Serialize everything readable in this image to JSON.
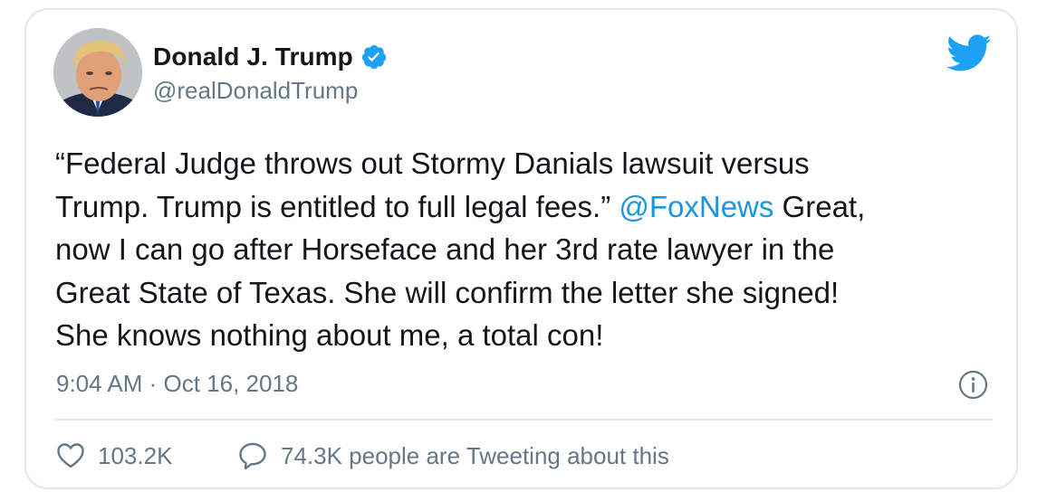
{
  "tweet": {
    "author": {
      "display_name": "Donald J. Trump",
      "handle": "@realDonaldTrump",
      "avatar": "profile-photo",
      "verified_icon": "verified-badge-icon"
    },
    "text_before_mention": "“Federal Judge throws out Stormy Danials lawsuit versus\nTrump. Trump is entitled to full legal fees.” ",
    "mention": "@FoxNews",
    "text_after_mention": " Great,\nnow I can go after Horseface and her 3rd rate lawyer in the\nGreat State of Texas. She will confirm the letter she signed!\nShe knows nothing about me, a total con!",
    "timestamp": "9:04 AM · Oct 16, 2018",
    "likes": "103.2K",
    "talking_about": "74.3K people are Tweeting about this"
  },
  "icons": {
    "brand": "twitter-bird-icon",
    "info": "info-icon",
    "like": "heart-icon",
    "reply": "speech-bubble-icon"
  },
  "colors": {
    "brand_blue": "#1da1f2",
    "link_blue": "#1b95e0",
    "text_primary": "#14171a",
    "text_secondary": "#657786",
    "border": "#e1e8ed"
  }
}
